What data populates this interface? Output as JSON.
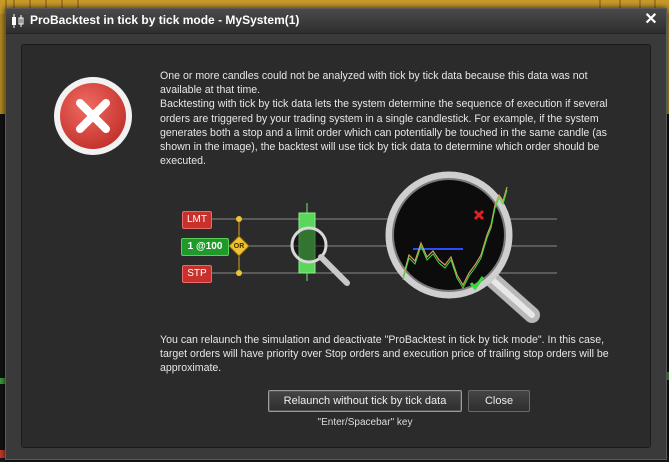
{
  "window": {
    "title": "ProBacktest in tick by tick mode - MySystem(1)",
    "close_glyph": "✕"
  },
  "icons": {
    "error": "error-x-icon",
    "app": "candlestick-app-icon",
    "magnifier": "magnifier-icon",
    "check": "checkmark-icon",
    "cross": "red-cross-icon"
  },
  "message": {
    "intro": "One or more candles could not be analyzed with tick by tick data because this data was not available at that time.",
    "explanation": "Backtesting with tick by tick data lets the system determine the sequence of execution if several orders are triggered by your trading system in a single candlestick. For example, if the system generates both a stop and a limit order which can potentially be touched in the same candle (as shown in the image), the backtest will use tick by tick data to determine which order should be executed.",
    "relaunch_info": "You can relaunch the simulation and deactivate \"ProBacktest in tick by tick mode\". In this case, target orders will have priority over Stop orders and execution price of trailing stop orders will be approximate."
  },
  "illustration": {
    "labels": {
      "lmt": "LMT",
      "entry": "1 @100",
      "stp": "STP",
      "or": "OR"
    }
  },
  "buttons": {
    "relaunch": "Relaunch without tick by tick data",
    "close": "Close"
  },
  "hint": "\"Enter/Spacebar\" key",
  "colors": {
    "error_red": "#d9453d",
    "lmt_red": "#c8302b",
    "entry_green": "#1f9a2a",
    "candle_green": "#5ad65a",
    "or_yellow": "#f2c230"
  }
}
